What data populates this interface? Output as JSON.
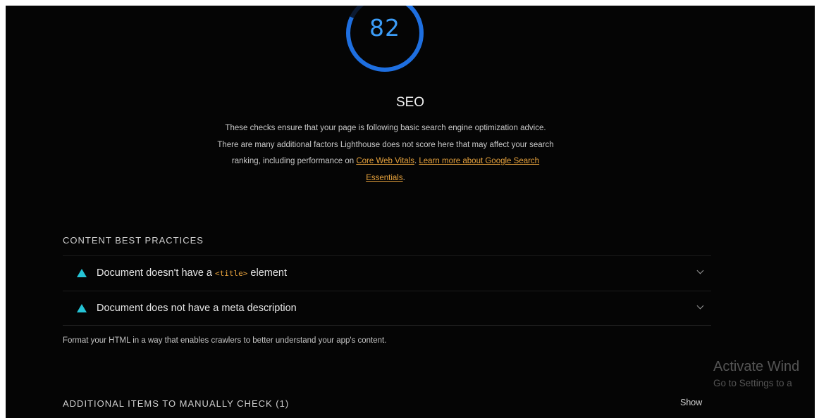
{
  "category": {
    "score": "82",
    "score_fraction": 0.82,
    "title": "SEO",
    "description_text": "These checks ensure that your page is following basic search engine optimization advice. There are many additional factors Lighthouse does not score here that may affect your search ranking, including performance on ",
    "link1": "Core Web Vitals",
    "separator": ". ",
    "link2": "Learn more about Google Search Essentials",
    "end_period": ".",
    "colors": {
      "gauge": "#1e6fe0",
      "score_text": "#3b9cf7",
      "link": "#e8a33d",
      "warn": "#25c4d6"
    }
  },
  "content_best_practices": {
    "heading": "CONTENT BEST PRACTICES",
    "audits": [
      {
        "icon": "warning-triangle-icon",
        "prefix": "Document doesn't have a ",
        "code": "<title>",
        "suffix": " element"
      },
      {
        "icon": "warning-triangle-icon",
        "text": "Document does not have a meta description"
      }
    ],
    "group_description": "Format your HTML in a way that enables crawlers to better understand your app's content."
  },
  "manual_checks": {
    "heading": "ADDITIONAL ITEMS TO MANUALLY CHECK (1)",
    "show_label": "Show"
  },
  "watermark": {
    "line1": "Activate Wind",
    "line2": "Go to Settings to a"
  }
}
